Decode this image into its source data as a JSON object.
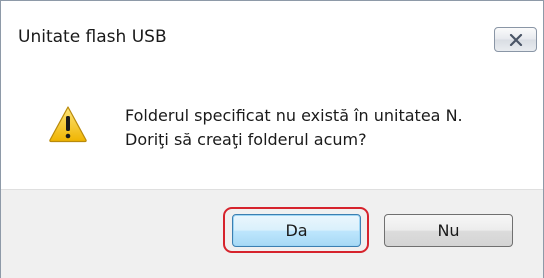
{
  "window": {
    "title": "Unitate flash USB"
  },
  "message": {
    "line1": "Folderul specificat nu există în unitatea N.",
    "line2": "Doriţi să creaţi folderul acum?"
  },
  "buttons": {
    "yes_label": "Da",
    "no_label": "Nu"
  },
  "icons": {
    "dialog_icon": "warning-icon",
    "close_icon": "close-icon"
  },
  "colors": {
    "highlight": "#d6232c",
    "warning_yellow": "#f5c21a"
  }
}
